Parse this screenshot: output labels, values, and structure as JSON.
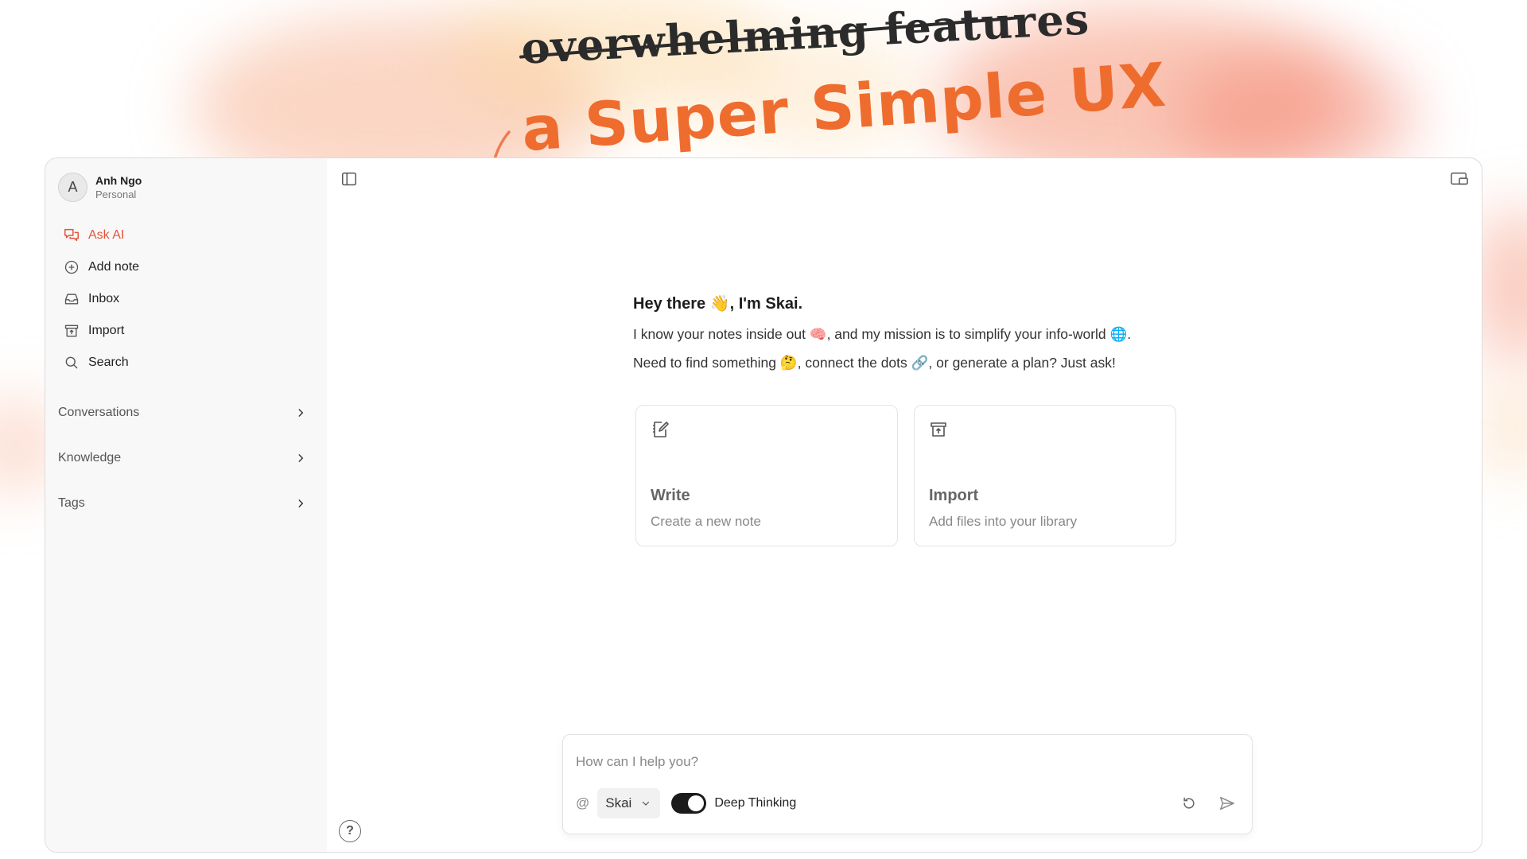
{
  "banner": {
    "old_text": "overwhelming features",
    "new_text": "a Super Simple UX"
  },
  "profile": {
    "initial": "A",
    "name": "Anh Ngo",
    "workspace": "Personal"
  },
  "nav": [
    {
      "label": "Ask AI",
      "icon": "chat-bubbles-icon",
      "active": true
    },
    {
      "label": "Add note",
      "icon": "plus-circle-icon"
    },
    {
      "label": "Inbox",
      "icon": "inbox-tray-icon"
    },
    {
      "label": "Import",
      "icon": "archive-box-icon"
    },
    {
      "label": "Search",
      "icon": "search-icon"
    }
  ],
  "sections": [
    {
      "label": "Conversations"
    },
    {
      "label": "Knowledge"
    },
    {
      "label": "Tags"
    }
  ],
  "help_label": "?",
  "welcome": {
    "greeting": "Hey there 👋, I'm Skai.",
    "line1": "I know your notes inside out 🧠, and my mission is to simplify your info-world 🌐.",
    "line2": "Need to find something 🤔, connect the dots 🔗, or generate a plan? Just ask!"
  },
  "cards": [
    {
      "title": "Write",
      "subtitle": "Create a new note",
      "icon": "edit-note-icon"
    },
    {
      "title": "Import",
      "subtitle": "Add files into your library",
      "icon": "archive-box-icon"
    }
  ],
  "composer": {
    "placeholder": "How can I help you?",
    "at_symbol": "@",
    "model": "Skai",
    "toggle_label": "Deep Thinking",
    "toggle_on": true
  },
  "colors": {
    "accent": "#e0543a",
    "headline": "#ef6c2f"
  }
}
